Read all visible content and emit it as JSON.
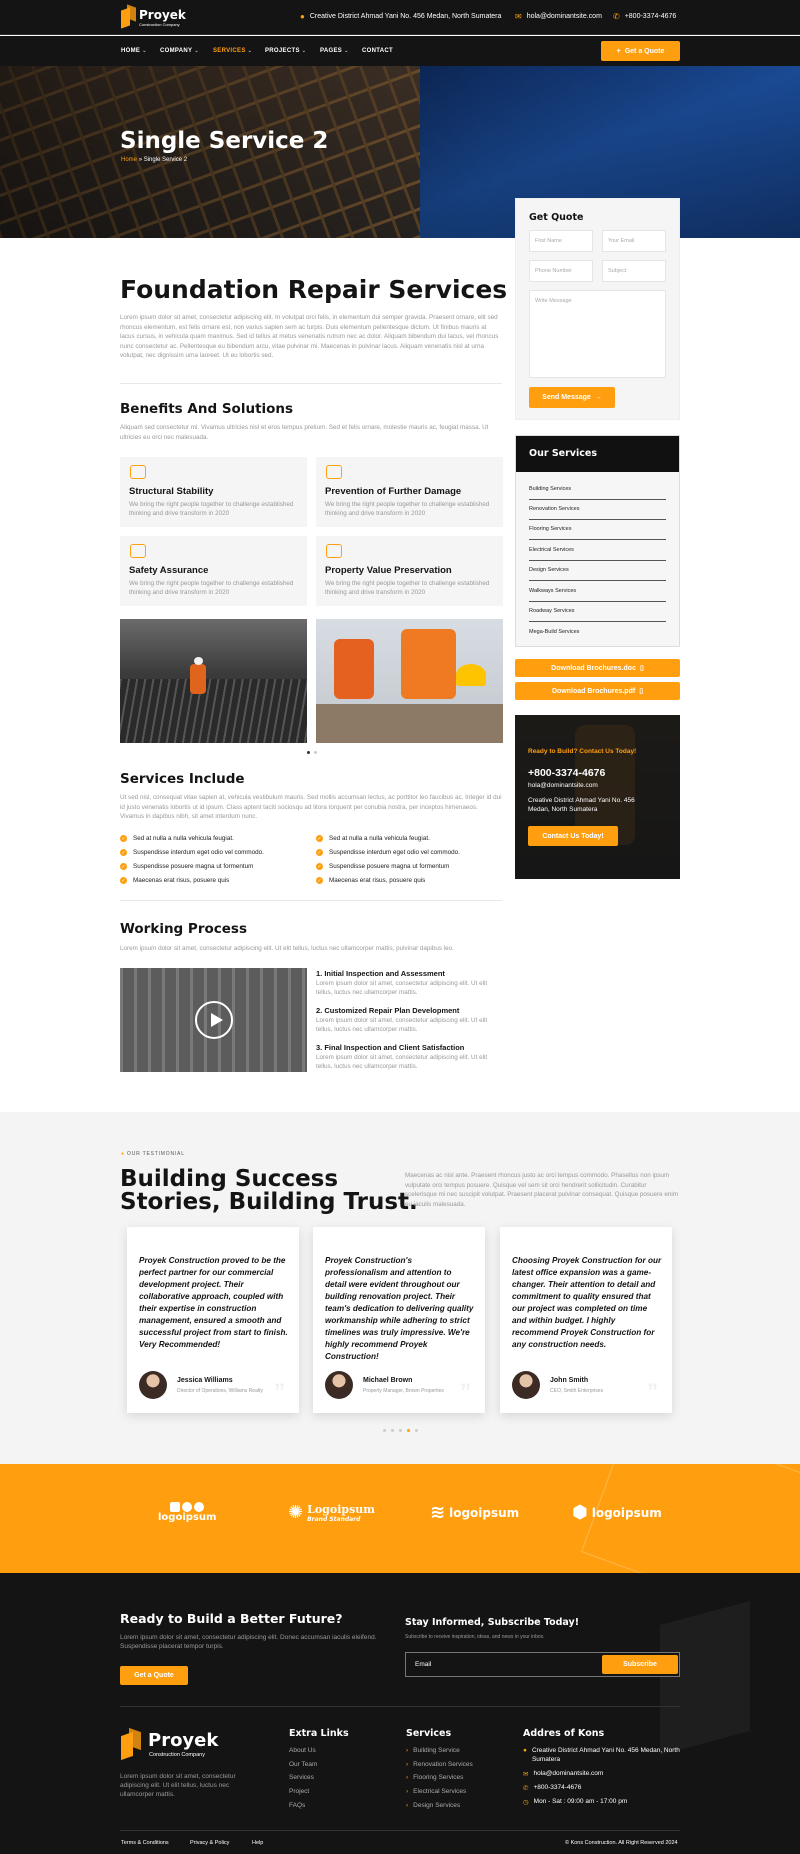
{
  "brand": {
    "name": "Proyek",
    "tagline": "Construction Company",
    "accent": "#ff9f0f",
    "dark": "#141414"
  },
  "topbar": {
    "address": "Creative District Ahmad Yani No. 456 Medan, North Sumatera",
    "email": "hola@dominantsite.com",
    "phone": "+800-3374-4676",
    "address_icon": "map-pin-icon",
    "email_icon": "envelope-icon",
    "phone_icon": "phone-icon"
  },
  "nav": {
    "items": [
      {
        "label": "HOME",
        "dropdown": true
      },
      {
        "label": "COMPANY",
        "dropdown": true
      },
      {
        "label": "SERVICES",
        "dropdown": true,
        "active": true
      },
      {
        "label": "PROJECTS",
        "dropdown": true
      },
      {
        "label": "PAGES",
        "dropdown": true
      },
      {
        "label": "CONTACT",
        "dropdown": false
      }
    ],
    "cta": "Get a Quote"
  },
  "hero": {
    "title": "Single Service 2",
    "breadcrumb_home": "Home",
    "breadcrumb_sep": "»",
    "breadcrumb_current": "Single Service 2"
  },
  "main": {
    "title": "Foundation Repair Services",
    "intro": "Lorem ipsum dolor sit amet, consectetur adipiscing elit. In volutpat orci felis, in elementum dui semper gravida. Praesent ornare, elit sed rhoncus elementum, est felis ornare est, non varius sapien sem ac turpis. Duis elementum pellentesque dictum. Ut finibus mauris at lacus cursus, in vehicula quam maximus. Sed id tellus at metus venenatis rutrum nec ac dolor. Aliquam bibendum dui lacus, vel rhoncus nunc consectetur ac. Pellentesque eu bibendum arcu, vitae pulvinar mi. Maecenas in pulvinar lacus. Aliquam venenatis nisl at urna volutpat, nec dignissim urna laoreet. Ut eu lobortis sed.",
    "benefits": {
      "title": "Benefits And Solutions",
      "text": "Aliquam sed consectetur mi. Vivamus ultricies nisl et eros tempus pretium. Sed et felis ornare, molestie mauris ac, feugiat massa. Ut ultricies eu orci nec malesuada.",
      "cards": [
        {
          "icon": "layers-icon",
          "title": "Structural Stability",
          "desc": "We bring the right people together to challenge established thinking and drive transform in 2020"
        },
        {
          "icon": "helmet-icon",
          "title": "Prevention of Further Damage",
          "desc": "We bring the right people together to challenge established thinking and drive transform in 2020"
        },
        {
          "icon": "hardhat-icon",
          "title": "Safety Assurance",
          "desc": "We bring the right people together to challenge established thinking and drive transform in 2020"
        },
        {
          "icon": "building-icon",
          "title": "Property Value Preservation",
          "desc": "We bring the right people together to challenge established thinking and drive transform in 2020"
        }
      ]
    },
    "includes": {
      "title": "Services Include",
      "text": "Ut sed nisl, consequat vitae sapien at, vehicula vestibulum mauris. Sed mollis accumsan lectus, ac porttitor leo faucibus ac. Integer id dui id justo venenatis lobortis ut id ipsum. Class aptent taciti sociosqu ad litora torquent per conubia nostra, per inceptos himenaeos. Vivamus in dapibus nibh, sit amet interdum nunc.",
      "left": [
        "Sed at nulla a nulla vehicula feugiat.",
        "Suspendisse interdum eget odio vel commodo.",
        "Suspendisse posuere magna ut formentum",
        "Maecenas erat risus, posuere quis"
      ],
      "right": [
        "Sed at nulla a nulla vehicula feugiat.",
        "Suspendisse interdum eget odio vel commodo.",
        "Suspendisse posuere magna ut formentum",
        "Maecenas erat risus, posuere quis"
      ]
    },
    "process": {
      "title": "Working Process",
      "text": "Lorem ipsum dolor sit amet, consectetur adipiscing elit. Ut elit tellus, luctus nec ullamcorper mattis, pulvinar dapibus leo.",
      "steps": [
        {
          "title": "1. Initial Inspection and Assessment",
          "desc": "Lorem ipsum dolor sit amet, consectetur adipiscing elit. Ut elit tellus, luctus nec ullamcorper mattis."
        },
        {
          "title": "2. Customized Repair Plan Development",
          "desc": "Lorem ipsum dolor sit amet, consectetur adipiscing elit. Ut elit tellus, luctus nec ullamcorper mattis."
        },
        {
          "title": "3. Final Inspection and Client Satisfaction",
          "desc": "Lorem ipsum dolor sit amet, consectetur adipiscing elit. Ut elit tellus, luctus nec ullamcorper mattis."
        }
      ]
    }
  },
  "sidebar": {
    "quote": {
      "title": "Get Quote",
      "first_name": "First Name",
      "email": "Your Email",
      "phone": "Phone Number",
      "subject": "Subject",
      "message": "Write Message",
      "submit": "Send Message"
    },
    "services": {
      "title": "Our Services",
      "items": [
        "Building Services",
        "Renovation Services",
        "Flooring Services",
        "Electrical Services",
        "Design Services",
        "Walkways Services",
        "Roadway Services",
        "Mega-Build Services"
      ]
    },
    "downloads": [
      "Download Brochures.doc",
      "Download Brochures.pdf"
    ],
    "cta": {
      "kicker": "Ready to Build? Contact Us Today!",
      "phone": "+800-3374-4676",
      "email": "hola@dominantsite.com",
      "address": "Creative District Ahmad Yani No. 456 Medan, North Sumatera",
      "button": "Contact Us Today!"
    }
  },
  "testimonials": {
    "kicker": "OUR TESTIMONIAL",
    "title_line1": "Building Success",
    "title_line2": "Stories, Building Trust.",
    "text": "Maecenas ac nisl ante. Praesent rhoncus justo ac orci tempus commodo. Phasellus non ipsum vulputate orci tempus posuere. Quisque vel sem sit orci hendrerit sollicitudin. Curabitur scelerisque mi nec suscipit volutpat. Praesent placerat pulvinar consequat. Quisque posuere enim eu iaculis malesuada.",
    "items": [
      {
        "quote": "Proyek Construction proved to be the perfect partner for our commercial development project. Their collaborative approach, coupled with their expertise in construction management, ensured a smooth and successful project from start to finish. Very Recommended!",
        "name": "Jessica Williams",
        "role": "Director of Operations, Williams Realty"
      },
      {
        "quote": "Proyek Construction's professionalism and attention to detail were evident throughout our building renovation project. Their team's dedication to delivering quality workmanship while adhering to strict timelines was truly impressive. We're highly recommend Proyek Construction!",
        "name": "Michael Brown",
        "role": "Property Manager, Brown Properties"
      },
      {
        "quote": "Choosing Proyek Construction for our latest office expansion was a game-changer. Their attention to detail and commitment to quality ensured that our project was completed on time and within budget. I highly recommend Proyek Construction for any construction needs.",
        "name": "John Smith",
        "role": "CEO, Smith Enterprises"
      }
    ]
  },
  "logos": [
    {
      "name": "logoipsum",
      "icon": "circles-logo-icon"
    },
    {
      "name": "Logoipsum",
      "sub": "Brand Standard",
      "icon": "sunburst-logo-icon"
    },
    {
      "name": "logoipsum",
      "icon": "waves-logo-icon"
    },
    {
      "name": "logoipsum",
      "icon": "hex-logo-icon"
    }
  ],
  "footer": {
    "cta_title": "Ready to Build a Better Future?",
    "cta_text": "Lorem ipsum dolor sit amet, consectetur adipiscing elit. Donec accumsan iaculis eleifend. Suspendisse placerat tempor turpis.",
    "cta_button": "Get a Quote",
    "subscribe_title": "Stay Informed, Subscribe Today!",
    "subscribe_text": "Subscribe to receive inspiration, ideas, and news in your inbox.",
    "email_placeholder": "Email",
    "subscribe_button": "Subscribe",
    "about": "Lorem ipsum dolor sit amet, consectetur adipiscing elit. Ut elit tellus, luctus nec ullamcorper mattis.",
    "extra_title": "Extra Links",
    "extra": [
      "About Us",
      "Our Team",
      "Services",
      "Project",
      "FAQs"
    ],
    "services_title": "Services",
    "services": [
      "Building Service",
      "Renovation Services",
      "Flooring Services",
      "Electrical Services",
      "Design Services"
    ],
    "address_title": "Addres of Kons",
    "address": "Creative District Ahmad Yani No. 456 Medan, North Sumatera",
    "email": "hola@dominantsite.com",
    "phone": "+800-3374-4676",
    "hours": "Mon - Sat : 09:00 am - 17:00 pm",
    "bottom_links": [
      "Terms & Conditions",
      "Privacy & Policy",
      "Help"
    ],
    "copyright": "© Kons Construction. All Right Reserved 2024"
  }
}
